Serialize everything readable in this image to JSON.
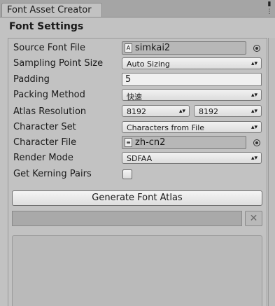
{
  "window": {
    "tab_title": "Font Asset Creator",
    "controls": [
      "⋮",
      "×"
    ]
  },
  "header": {
    "title": "Font Settings"
  },
  "fields": {
    "source_font": {
      "label": "Source Font File",
      "value": "simkai2",
      "icon": "font-file-icon"
    },
    "sampling_point_size": {
      "label": "Sampling Point Size",
      "value": "Auto Sizing"
    },
    "padding": {
      "label": "Padding",
      "value": "5"
    },
    "packing_method": {
      "label": "Packing Method",
      "value": "快速"
    },
    "atlas_resolution": {
      "label": "Atlas Resolution",
      "width": "8192",
      "height": "8192"
    },
    "character_set": {
      "label": "Character Set",
      "value": "Characters from File"
    },
    "character_file": {
      "label": "Character File",
      "value": "zh-cn2",
      "icon": "text-file-icon"
    },
    "render_mode": {
      "label": "Render Mode",
      "value": "SDFAA"
    },
    "get_kerning_pairs": {
      "label": "Get Kerning Pairs",
      "checked": false
    }
  },
  "actions": {
    "generate_label": "Generate Font Atlas",
    "clear_label": "✕"
  },
  "progress": {
    "value": 0
  }
}
